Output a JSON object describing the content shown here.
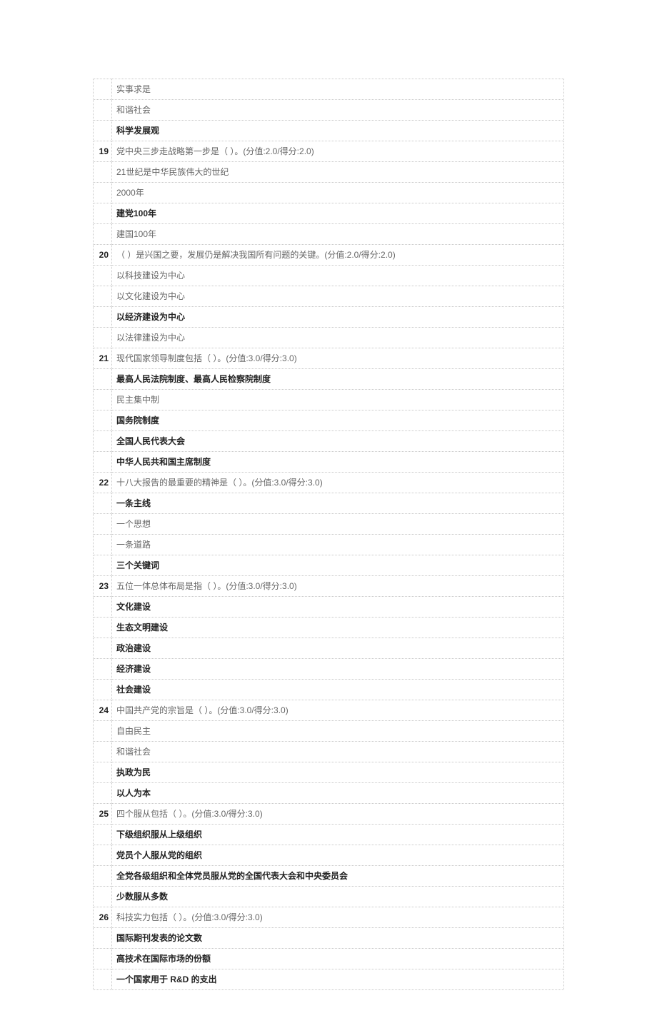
{
  "rows": [
    {
      "num": "",
      "text": "实事求是",
      "bold": false
    },
    {
      "num": "",
      "text": "和谐社会",
      "bold": false
    },
    {
      "num": "",
      "text": "科学发展观",
      "bold": true
    },
    {
      "num": "19",
      "text": "党中央三步走战略第一步是（ ）。(分值:2.0/得分:2.0)",
      "bold": false
    },
    {
      "num": "",
      "text": "21世纪是中华民族伟大的世纪",
      "bold": false
    },
    {
      "num": "",
      "text": "2000年",
      "bold": false
    },
    {
      "num": "",
      "text": "建党100年",
      "bold": true
    },
    {
      "num": "",
      "text": "建国100年",
      "bold": false
    },
    {
      "num": "20",
      "text": "（ ）是兴国之要，发展仍是解决我国所有问题的关键。(分值:2.0/得分:2.0)",
      "bold": false
    },
    {
      "num": "",
      "text": "以科技建设为中心",
      "bold": false
    },
    {
      "num": "",
      "text": "以文化建设为中心",
      "bold": false
    },
    {
      "num": "",
      "text": "以经济建设为中心",
      "bold": true
    },
    {
      "num": "",
      "text": "以法律建设为中心",
      "bold": false
    },
    {
      "num": "21",
      "text": "现代国家领导制度包括（ ）。(分值:3.0/得分:3.0)",
      "bold": false
    },
    {
      "num": "",
      "text": "最高人民法院制度、最高人民检察院制度",
      "bold": true
    },
    {
      "num": "",
      "text": "民主集中制",
      "bold": false
    },
    {
      "num": "",
      "text": "国务院制度",
      "bold": true
    },
    {
      "num": "",
      "text": "全国人民代表大会",
      "bold": true
    },
    {
      "num": "",
      "text": "中华人民共和国主席制度",
      "bold": true
    },
    {
      "num": "22",
      "text": "十八大报告的最重要的精神是（ ）。(分值:3.0/得分:3.0)",
      "bold": false
    },
    {
      "num": "",
      "text": "一条主线",
      "bold": true
    },
    {
      "num": "",
      "text": "一个思想",
      "bold": false
    },
    {
      "num": "",
      "text": "一条道路",
      "bold": false
    },
    {
      "num": "",
      "text": "三个关键词",
      "bold": true
    },
    {
      "num": "23",
      "text": "五位一体总体布局是指（ ）。(分值:3.0/得分:3.0)",
      "bold": false
    },
    {
      "num": "",
      "text": "文化建设",
      "bold": true
    },
    {
      "num": "",
      "text": "生态文明建设",
      "bold": true
    },
    {
      "num": "",
      "text": "政治建设",
      "bold": true
    },
    {
      "num": "",
      "text": "经济建设",
      "bold": true
    },
    {
      "num": "",
      "text": "社会建设",
      "bold": true
    },
    {
      "num": "24",
      "text": "中国共产党的宗旨是（ ）。(分值:3.0/得分:3.0)",
      "bold": false
    },
    {
      "num": "",
      "text": "自由民主",
      "bold": false
    },
    {
      "num": "",
      "text": "和谐社会",
      "bold": false
    },
    {
      "num": "",
      "text": "执政为民",
      "bold": true
    },
    {
      "num": "",
      "text": "以人为本",
      "bold": true
    },
    {
      "num": "25",
      "text": "四个服从包括（ ）。(分值:3.0/得分:3.0)",
      "bold": false
    },
    {
      "num": "",
      "text": "下级组织服从上级组织",
      "bold": true
    },
    {
      "num": "",
      "text": "党员个人服从党的组织",
      "bold": true
    },
    {
      "num": "",
      "text": "全党各级组织和全体党员服从党的全国代表大会和中央委员会",
      "bold": true
    },
    {
      "num": "",
      "text": "少数服从多数",
      "bold": true
    },
    {
      "num": "26",
      "text": "科技实力包括（ ）。(分值:3.0/得分:3.0)",
      "bold": false
    },
    {
      "num": "",
      "text": "国际期刊发表的论文数",
      "bold": true
    },
    {
      "num": "",
      "text": "高技术在国际市场的份额",
      "bold": true
    },
    {
      "num": "",
      "text": "一个国家用于 R&D 的支出",
      "bold": true
    }
  ]
}
